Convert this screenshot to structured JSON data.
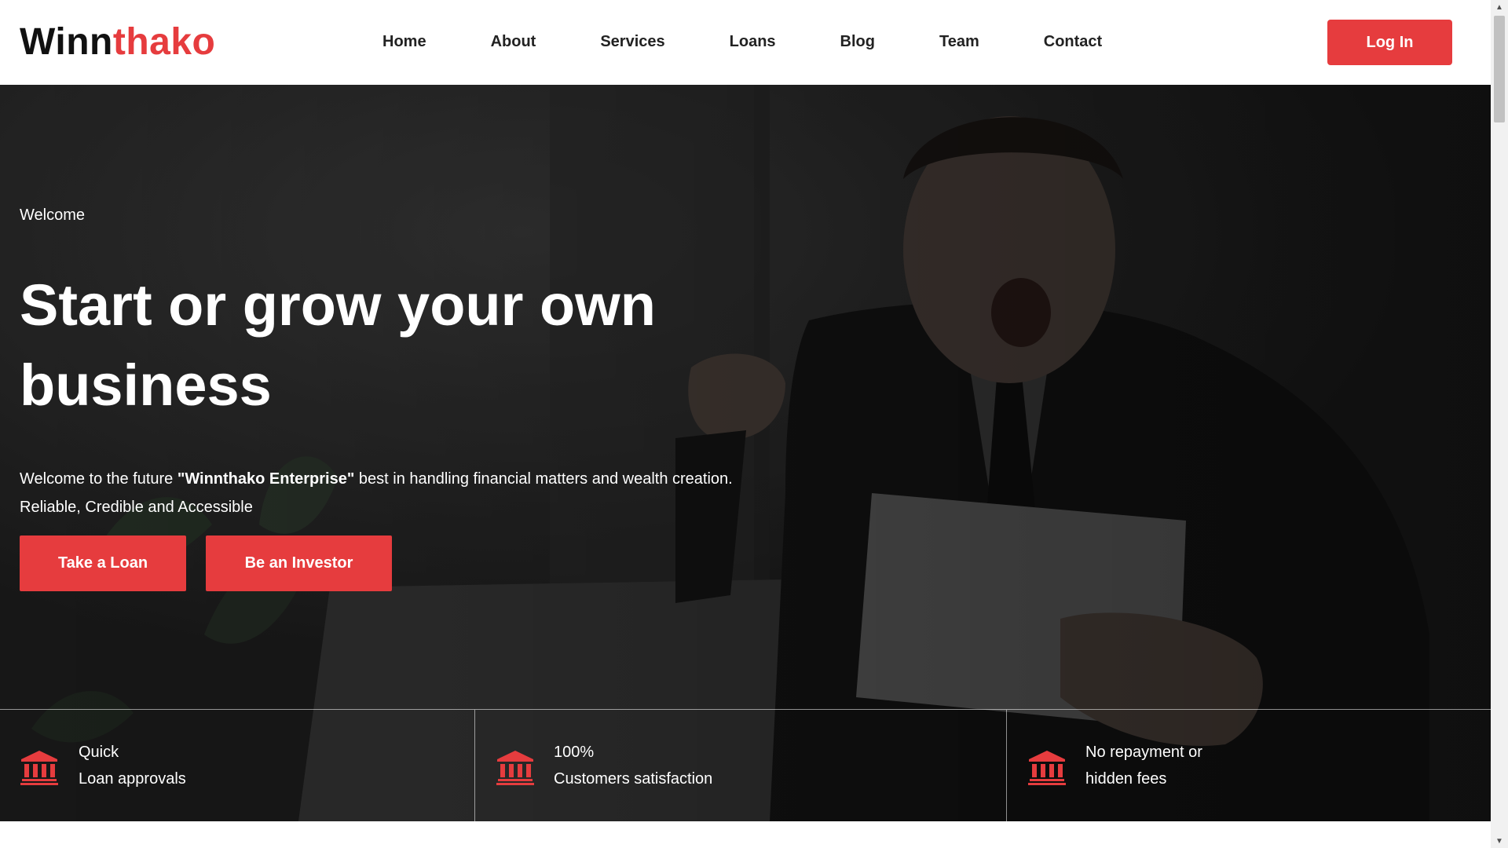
{
  "brand": {
    "part1": "Winn",
    "part2": "thako",
    "accent_color": "#e63c3e"
  },
  "nav": {
    "items": [
      "Home",
      "About",
      "Services",
      "Loans",
      "Blog",
      "Team",
      "Contact"
    ],
    "login_label": "Log In"
  },
  "hero": {
    "kicker": "Welcome",
    "title": "Start or grow your own business",
    "desc_prefix": "Welcome to the future ",
    "desc_brand": "\"Winnthako Enterprise\"",
    "desc_suffix": " best in handling financial matters and wealth creation.",
    "desc_line2": "Reliable, Credible and Accessible",
    "buttons": {
      "loan": "Take a Loan",
      "investor": "Be an Investor"
    }
  },
  "features": [
    {
      "icon": "bank-icon",
      "line1": "Quick",
      "line2": "Loan approvals"
    },
    {
      "icon": "bank-icon",
      "line1": "100%",
      "line2": "Customers satisfaction"
    },
    {
      "icon": "bank-icon",
      "line1": "No repayment or",
      "line2": "hidden fees"
    }
  ]
}
